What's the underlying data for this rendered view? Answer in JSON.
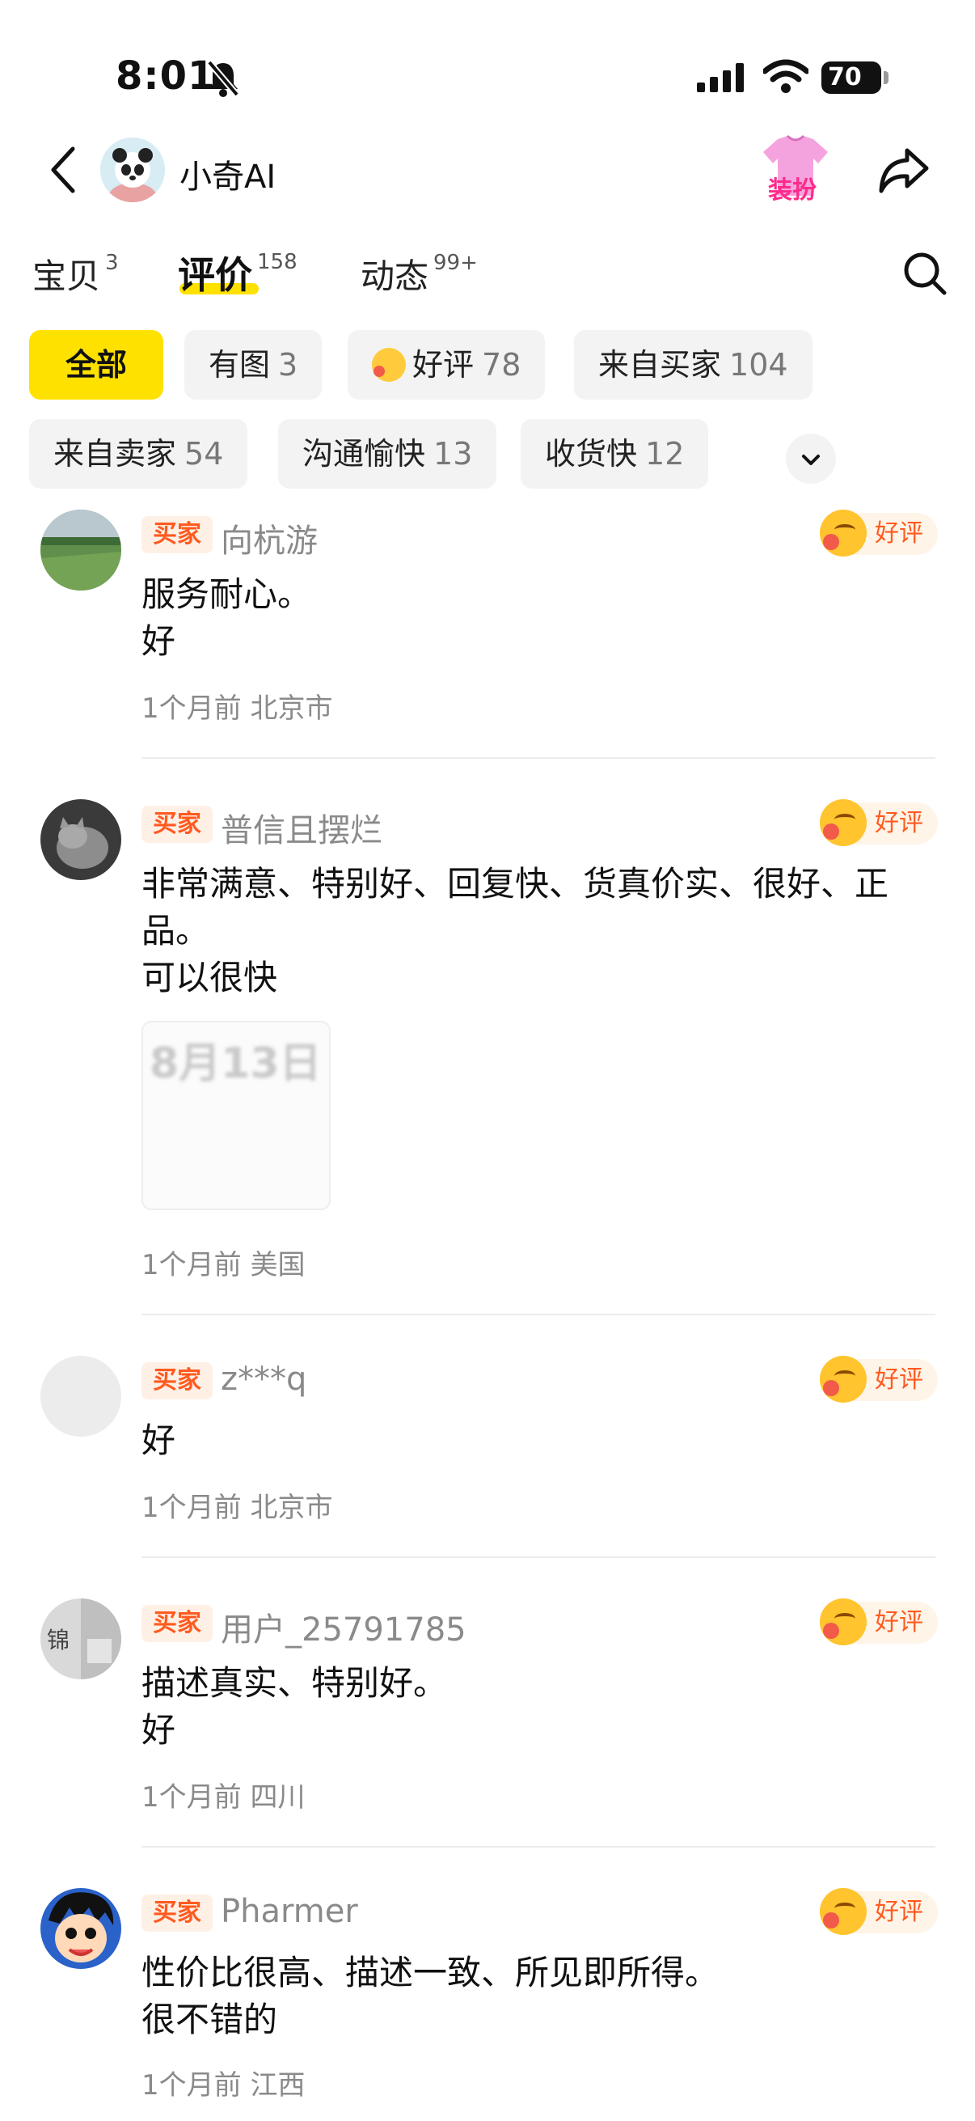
{
  "status_bar": {
    "time": "8:01",
    "battery": "70"
  },
  "header": {
    "shop_name": "小奇AI",
    "dress_label": "装扮"
  },
  "tabs": [
    {
      "label": "宝贝",
      "count": "3"
    },
    {
      "label": "评价",
      "count": "158"
    },
    {
      "label": "动态",
      "count": "99+"
    }
  ],
  "filters": [
    {
      "label": "全部",
      "count": ""
    },
    {
      "label": "有图",
      "count": "3"
    },
    {
      "label": "好评",
      "count": "78"
    },
    {
      "label": "来自买家",
      "count": "104"
    },
    {
      "label": "来自卖家",
      "count": "54"
    },
    {
      "label": "沟通愉快",
      "count": "13"
    },
    {
      "label": "收货快",
      "count": "12"
    }
  ],
  "reviews": [
    {
      "badge": "买家",
      "user": "向杭游",
      "rating": "好评",
      "lines": [
        "服务耐心。",
        "好"
      ],
      "time": "1个月前",
      "location": "北京市"
    },
    {
      "badge": "买家",
      "user": "普信且摆烂",
      "rating": "好评",
      "lines": [
        "非常满意、特别好、回复快、货真价实、很好、正",
        "品。",
        "可以很快"
      ],
      "photo_text": "8月13日",
      "time": "1个月前",
      "location": "美国"
    },
    {
      "badge": "买家",
      "user": "z***q",
      "rating": "好评",
      "lines": [
        "好"
      ],
      "time": "1个月前",
      "location": "北京市"
    },
    {
      "badge": "买家",
      "user": "用户_25791785",
      "rating": "好评",
      "lines": [
        "描述真实、特别好。",
        "好"
      ],
      "avatar_text": "锦",
      "time": "1个月前",
      "location": "四川"
    },
    {
      "badge": "买家",
      "user": "Pharmer",
      "rating": "好评",
      "lines": [
        "性价比很高、描述一致、所见即所得。",
        "很不错的"
      ],
      "time": "1个月前",
      "location": "江西"
    }
  ],
  "colors": {
    "accent_yellow": "#ffe100",
    "badge_orange": "#ff5a1f"
  }
}
